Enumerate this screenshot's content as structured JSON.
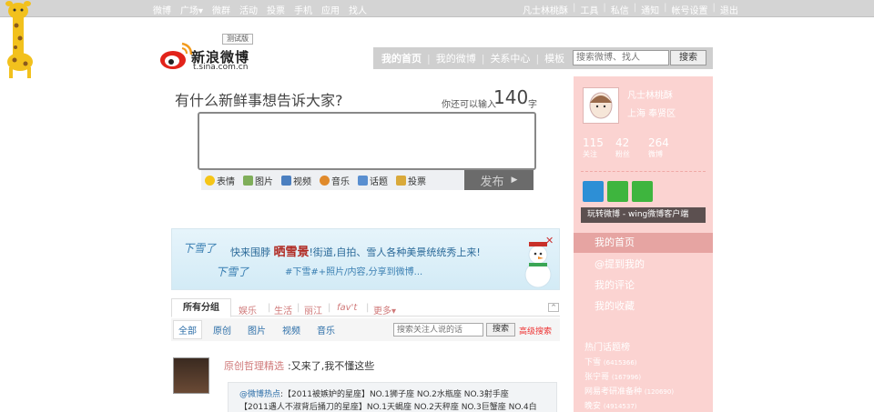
{
  "topnav": {
    "items": [
      "微博",
      "广场▾",
      "微群",
      "活动",
      "投票",
      "手机",
      "应用",
      "找人"
    ],
    "right": [
      "凡士林桃酥",
      "工具",
      "私信",
      "通知",
      "帐号设置",
      "退出"
    ]
  },
  "logo": {
    "name": "新浪微博",
    "url": "t.sina.com.cn",
    "beta": "测试版"
  },
  "mainnav": {
    "items": [
      "我的首页",
      "我的微博",
      "关系中心",
      "模板"
    ],
    "search_placeholder": "搜索微博、找人",
    "search_button": "搜索"
  },
  "compose": {
    "prompt": "有什么新鲜事想告诉大家?",
    "count_label": "你还可以输入",
    "count": "140",
    "count_unit": "字",
    "tools": [
      "表情",
      "图片",
      "视频",
      "音乐",
      "话题",
      "投票"
    ],
    "post_button": "发布"
  },
  "banner": {
    "snow": "下雪了",
    "headline_prefix": "快来围脖",
    "headline_bold": "晒雪景",
    "headline_rest": "!街道,自拍、雪人各种美景统统秀上来!",
    "subline": "#下雪#+照片/内容,分享到微博..."
  },
  "feed_tabs": {
    "all": "所有分组",
    "tabs": [
      "娱乐",
      "生活",
      "丽江",
      "fav't",
      "更多▾"
    ],
    "collapse": "^"
  },
  "feed_filter": {
    "items": [
      "全部",
      "原创",
      "图片",
      "视频",
      "音乐"
    ],
    "search_placeholder": "搜索关注人说的话",
    "search_button": "搜索",
    "advanced": "高级搜索"
  },
  "feed": {
    "author": "原创哲理精选",
    "text": ":又来了,我不懂这些",
    "quote_author": "@微博热点",
    "quote_line1": ":【2011被嫉妒的星座】NO.1狮子座 NO.2水瓶座 NO.3射手座",
    "quote_line2": "【2011遇人不淑背后捅刀的星座】NO.1天蝎座 NO.2天秤座 NO.3巨蟹座 NO.4白"
  },
  "profile": {
    "name": "凡士林桃酥",
    "location": "上海 奉贤区",
    "stats": [
      {
        "value": "115",
        "label": "关注"
      },
      {
        "value": "42",
        "label": "粉丝"
      },
      {
        "value": "264",
        "label": "微博"
      }
    ]
  },
  "wing": "玩转微博 - wing微博客户端",
  "rightnav": {
    "home": "我的首页",
    "items": [
      "@提到我的",
      "我的评论",
      "我的收藏"
    ]
  },
  "hot_topics": {
    "title": "热门话题榜",
    "items": [
      {
        "name": "下雪",
        "count": "(6415366)"
      },
      {
        "name": "张宁哥",
        "count": "(167996)"
      },
      {
        "name": "网易考研准备种",
        "count": "(120690)"
      },
      {
        "name": "晚安",
        "count": "(4914537)"
      }
    ]
  },
  "colors": {
    "sidebar": "#fbd3d1",
    "topbar": "#d4d4d4",
    "link": "#2c6ea8",
    "accent_red": "#e33"
  }
}
